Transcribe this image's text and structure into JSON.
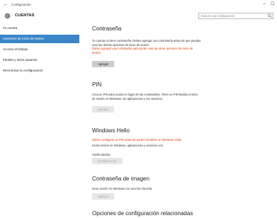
{
  "window": {
    "title": "Configuración",
    "back_icon": "back-arrow-icon",
    "minimize": "–",
    "maximize": "☐"
  },
  "header": {
    "title": "CUENTAS",
    "icon": "gear-icon"
  },
  "search": {
    "placeholder": "Buscar una configuración",
    "icon": "search-icon"
  },
  "sidebar": {
    "items": [
      {
        "label": "Tu cuenta",
        "active": false
      },
      {
        "label": "Opciones de inicio de sesión",
        "active": true
      },
      {
        "label": "Acceso al trabajo",
        "active": false
      },
      {
        "label": "Familia y otros usuarios",
        "active": false
      },
      {
        "label": "Sincronizar la configuración",
        "active": false
      }
    ]
  },
  "content": {
    "password": {
      "title": "Contraseña",
      "text": "Tu cuenta no tiene contraseña. Debes agregar una contraseña antes de que puedas usar las demás opciones de inicio de sesión.",
      "warning": "Debes agregar una contraseña para poder usar las otras opciones de inicio de sesión.",
      "button": "Agregar"
    },
    "pin": {
      "title": "PIN",
      "text": "Crea un PIN para usarlo en lugar de las contraseñas. Tener un PIN facilita el inicio de sesión en Windows, las aplicaciones y los servicios.",
      "button": "Agregar"
    },
    "hello": {
      "title": "Windows Hello",
      "warning": "Debes configurar un PIN antes de poder inscribirte en Windows Hello.",
      "text": "Iniciar sesión en Windows, aplicaciones y servicios con",
      "label": "Huella dactilar",
      "button": "Configuración"
    },
    "picture": {
      "title": "Contraseña de imagen",
      "text": "Inicia sesión en Windows con una foto favorita",
      "button": "Agregar"
    },
    "related": {
      "title": "Opciones de configuración relacionadas"
    }
  },
  "colors": {
    "accent": "#3a86c8",
    "warning": "#d83b01"
  }
}
